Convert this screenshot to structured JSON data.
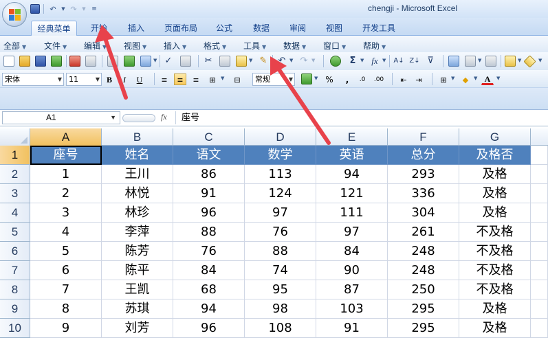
{
  "window": {
    "title": "chengji - Microsoft Excel"
  },
  "qat": {
    "undo": "↶",
    "redo": "↷",
    "customize": "≡"
  },
  "tabs": [
    "经典菜单",
    "开始",
    "插入",
    "页面布局",
    "公式",
    "数据",
    "审阅",
    "视图",
    "开发工具"
  ],
  "active_tab": "经典菜单",
  "menus": [
    "全部",
    "文件",
    "编辑",
    "视图",
    "插入",
    "格式",
    "工具",
    "数据",
    "窗口",
    "帮助"
  ],
  "toolbar": {
    "font_name": "宋体",
    "font_size": "11",
    "bold": "B",
    "italic": "I",
    "underline": "U",
    "number_format": "常规",
    "percent": "%",
    "comma": ",",
    "sum": "Σ",
    "fx": "fx"
  },
  "formula_bar": {
    "name_box": "A1",
    "fx_label": "fx",
    "content": "座号"
  },
  "sheet": {
    "columns": [
      "A",
      "B",
      "C",
      "D",
      "E",
      "F",
      "G"
    ],
    "row_numbers": [
      "1",
      "2",
      "3",
      "4",
      "5",
      "6",
      "7",
      "8",
      "9",
      "10"
    ],
    "rows": [
      [
        "座号",
        "姓名",
        "语文",
        "数学",
        "英语",
        "总分",
        "及格否"
      ],
      [
        "1",
        "王川",
        "86",
        "113",
        "94",
        "293",
        "及格"
      ],
      [
        "2",
        "林悦",
        "91",
        "124",
        "121",
        "336",
        "及格"
      ],
      [
        "3",
        "林珍",
        "96",
        "97",
        "111",
        "304",
        "及格"
      ],
      [
        "4",
        "李萍",
        "88",
        "76",
        "97",
        "261",
        "不及格"
      ],
      [
        "5",
        "陈芳",
        "76",
        "88",
        "84",
        "248",
        "不及格"
      ],
      [
        "6",
        "陈平",
        "84",
        "74",
        "90",
        "248",
        "不及格"
      ],
      [
        "7",
        "王凯",
        "68",
        "95",
        "87",
        "250",
        "不及格"
      ],
      [
        "8",
        "苏琪",
        "94",
        "98",
        "103",
        "295",
        "及格"
      ],
      [
        "9",
        "刘芳",
        "96",
        "108",
        "91",
        "295",
        "及格"
      ]
    ]
  },
  "colors": {
    "header_fill": "#4f81bd",
    "arrow": "#e8424b",
    "selection": "#f1c15f"
  }
}
